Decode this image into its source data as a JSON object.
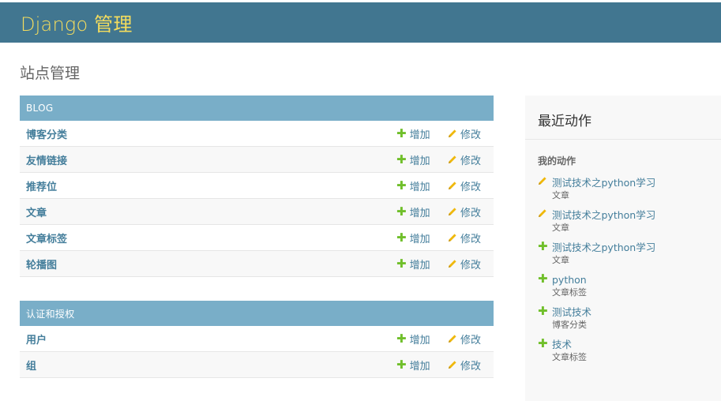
{
  "header": {
    "branding": "Django 管理"
  },
  "page": {
    "title": "站点管理"
  },
  "modules": [
    {
      "caption": "BLOG",
      "rows": [
        {
          "name": "博客分类",
          "add": "增加",
          "change": "修改"
        },
        {
          "name": "友情链接",
          "add": "增加",
          "change": "修改"
        },
        {
          "name": "推荐位",
          "add": "增加",
          "change": "修改"
        },
        {
          "name": "文章",
          "add": "增加",
          "change": "修改"
        },
        {
          "name": "文章标签",
          "add": "增加",
          "change": "修改"
        },
        {
          "name": "轮播图",
          "add": "增加",
          "change": "修改"
        }
      ]
    },
    {
      "caption": "认证和授权",
      "rows": [
        {
          "name": "用户",
          "add": "增加",
          "change": "修改"
        },
        {
          "name": "组",
          "add": "增加",
          "change": "修改"
        }
      ]
    }
  ],
  "recent": {
    "title": "最近动作",
    "subtitle": "我的动作",
    "actions": [
      {
        "icon": "edit-icon",
        "title": "测试技术之python学习",
        "type": "文章"
      },
      {
        "icon": "edit-icon",
        "title": "测试技术之python学习",
        "type": "文章"
      },
      {
        "icon": "add-icon",
        "title": "测试技术之python学习",
        "type": "文章"
      },
      {
        "icon": "add-icon",
        "title": "python",
        "type": "文章标签"
      },
      {
        "icon": "add-icon",
        "title": "测试技术",
        "type": "博客分类"
      },
      {
        "icon": "add-icon",
        "title": "技术",
        "type": "文章标签"
      }
    ]
  },
  "colors": {
    "header_bg": "#417690",
    "branding": "#f5dd5d",
    "caption_bg": "#79aec8",
    "link": "#447e9b",
    "add_green": "#70bf2b",
    "edit_yellow": "#efb80b"
  }
}
